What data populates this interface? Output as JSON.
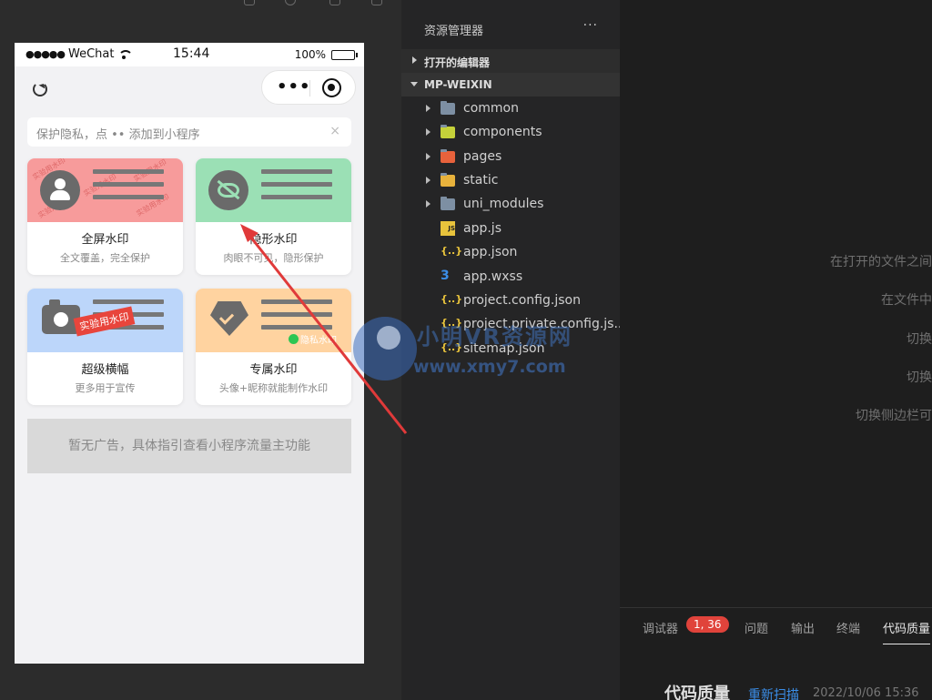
{
  "colors": {
    "card_red": "#f79b9b",
    "card_green": "#9be0b5",
    "card_blue": "#bcd6fa",
    "card_orange": "#ffd3a0",
    "badge_red": "#e0433b",
    "arrow_red": "#e03a3a",
    "link_blue": "#3b8ee8"
  },
  "statusbar": {
    "carrier": "WeChat",
    "time": "15:44",
    "battery": "100%"
  },
  "navbar": {
    "refresh_icon": "refresh-icon",
    "capsule_more": "•••",
    "capsule_close_icon": "target-icon"
  },
  "tip": {
    "text": "保护隐私，点 •• 添加到小程序",
    "close": "×"
  },
  "cards": [
    {
      "title": "全屏水印",
      "subtitle": "全文覆盖，完全保护",
      "icon": "person-icon",
      "watermark": "实验用水印"
    },
    {
      "title": "隐形水印",
      "subtitle": "肉眼不可见，隐形保护",
      "icon": "eye-slash-icon"
    },
    {
      "title": "超级横幅",
      "subtitle": "更多用于宣传",
      "icon": "camera-icon",
      "banner": "实验用水印"
    },
    {
      "title": "专属水印",
      "subtitle": "头像+昵称就能制作水印",
      "icon": "diamond-icon",
      "badge": "隐私水印"
    }
  ],
  "ad": {
    "text": "暂无广告，具体指引查看小程序流量主功能"
  },
  "explorer": {
    "header": "资源管理器",
    "more": "···",
    "sections": {
      "open_editors": "打开的编辑器",
      "project": "MP-WEIXIN"
    },
    "items": [
      {
        "name": "common",
        "icon": "folder-icon"
      },
      {
        "name": "components",
        "icon": "folder-icon"
      },
      {
        "name": "pages",
        "icon": "folder-icon"
      },
      {
        "name": "static",
        "icon": "folder-icon"
      },
      {
        "name": "uni_modules",
        "icon": "folder-icon"
      },
      {
        "name": "app.js",
        "icon": "js-file-icon"
      },
      {
        "name": "app.json",
        "icon": "json-file-icon"
      },
      {
        "name": "app.wxss",
        "icon": "css-file-icon"
      },
      {
        "name": "project.config.json",
        "icon": "json-file-icon"
      },
      {
        "name": "project.private.config.js...",
        "icon": "json-file-icon"
      },
      {
        "name": "sitemap.json",
        "icon": "json-file-icon"
      }
    ]
  },
  "watermark": {
    "cn": "小明VR资源网",
    "en": "www.xmy7.com"
  },
  "editor_hints": [
    "在打开的文件之间",
    "在文件中",
    "切换",
    "切换",
    "切换侧边栏可"
  ],
  "panel": {
    "tabs": [
      "调试器",
      "问题",
      "输出",
      "终端",
      "代码质量"
    ],
    "badge": "1, 36",
    "title": "代码质量",
    "rescan": "重新扫描",
    "time": "2022/10/06 15:36"
  }
}
